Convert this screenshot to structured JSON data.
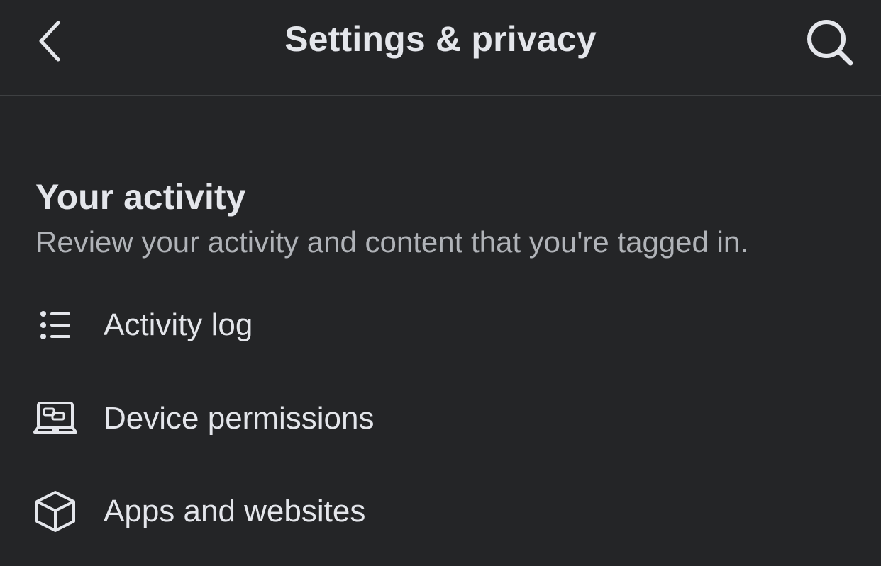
{
  "header": {
    "title": "Settings & privacy",
    "back_icon": "chevron-left-icon",
    "search_icon": "search-icon"
  },
  "section": {
    "title": "Your activity",
    "subtitle": "Review your activity and content that you're tagged in."
  },
  "items": [
    {
      "label": "Activity log",
      "icon": "list-icon"
    },
    {
      "label": "Device permissions",
      "icon": "laptop-icon"
    },
    {
      "label": "Apps and websites",
      "icon": "cube-icon"
    }
  ],
  "colors": {
    "background": "#242527",
    "text_primary": "#e4e6eb",
    "text_secondary": "#b0b3b8",
    "divider": "#3e4042"
  }
}
